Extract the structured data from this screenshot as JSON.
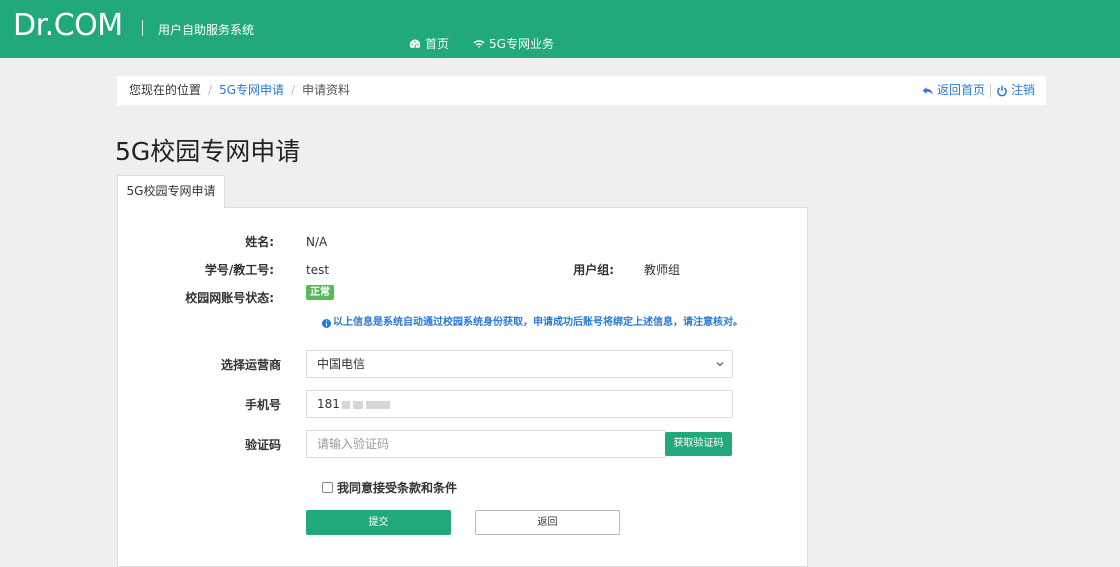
{
  "header": {
    "brand": "Dr.COM",
    "subtitle": "用户自助服务系统",
    "nav": [
      {
        "label": "首页",
        "icon": "dashboard-icon"
      },
      {
        "label": "5G专网业务",
        "icon": "wifi-icon"
      }
    ]
  },
  "breadcrumb": {
    "prefix": "您现在的位置",
    "items": [
      "5G专网申请",
      "申请资料"
    ],
    "actions": [
      {
        "label": "返回首页",
        "icon": "reply-icon"
      },
      {
        "label": "注销",
        "icon": "power-icon"
      }
    ]
  },
  "page_title": "5G校园专网申请",
  "tab_label": "5G校园专网申请",
  "info": {
    "name_label": "姓名:",
    "name_value": "N/A",
    "id_label": "学号/教工号:",
    "id_value": "test",
    "group_label": "用户组:",
    "group_value": "教师组",
    "status_label": "校园网账号状态:",
    "status_value": "正常",
    "notice": "以上信息是系统自动通过校园系统身份获取，申请成功后账号将绑定上述信息，请注意核对。"
  },
  "form": {
    "carrier_label": "选择运营商",
    "carrier_value": "中国电信",
    "phone_label": "手机号",
    "phone_value": "181",
    "code_label": "验证码",
    "code_placeholder": "请输入验证码",
    "get_code_label": "获取验证码",
    "agree_label": "我同意接受条款和条件",
    "submit_label": "提交",
    "back_label": "返回"
  },
  "colors": {
    "brand_green": "#21a97c",
    "link_blue": "#2a7ad2",
    "badge_green": "#5cb85c"
  }
}
